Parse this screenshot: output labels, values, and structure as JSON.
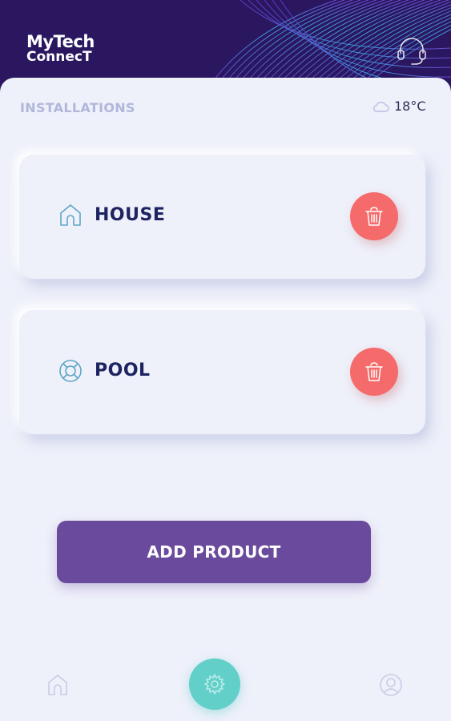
{
  "app": {
    "logo_line1": "MyTech",
    "logo_line2": "ConnecT"
  },
  "installations": {
    "title": "INSTALLATIONS",
    "temperature": "18°C",
    "items": [
      {
        "label": "HOUSE",
        "icon": "house-icon"
      },
      {
        "label": "POOL",
        "icon": "lifebuoy-icon"
      }
    ]
  },
  "actions": {
    "add_product_label": "ADD PRODUCT"
  },
  "bottom_nav": {
    "items": [
      "home-icon",
      "gear-icon",
      "user-icon"
    ]
  },
  "colors": {
    "header_bg": "#2a1760",
    "accent_purple": "#6a4a9c",
    "delete_red": "#f56a6a",
    "settings_teal": "#62cfc9",
    "title_navy": "#1e2462"
  }
}
